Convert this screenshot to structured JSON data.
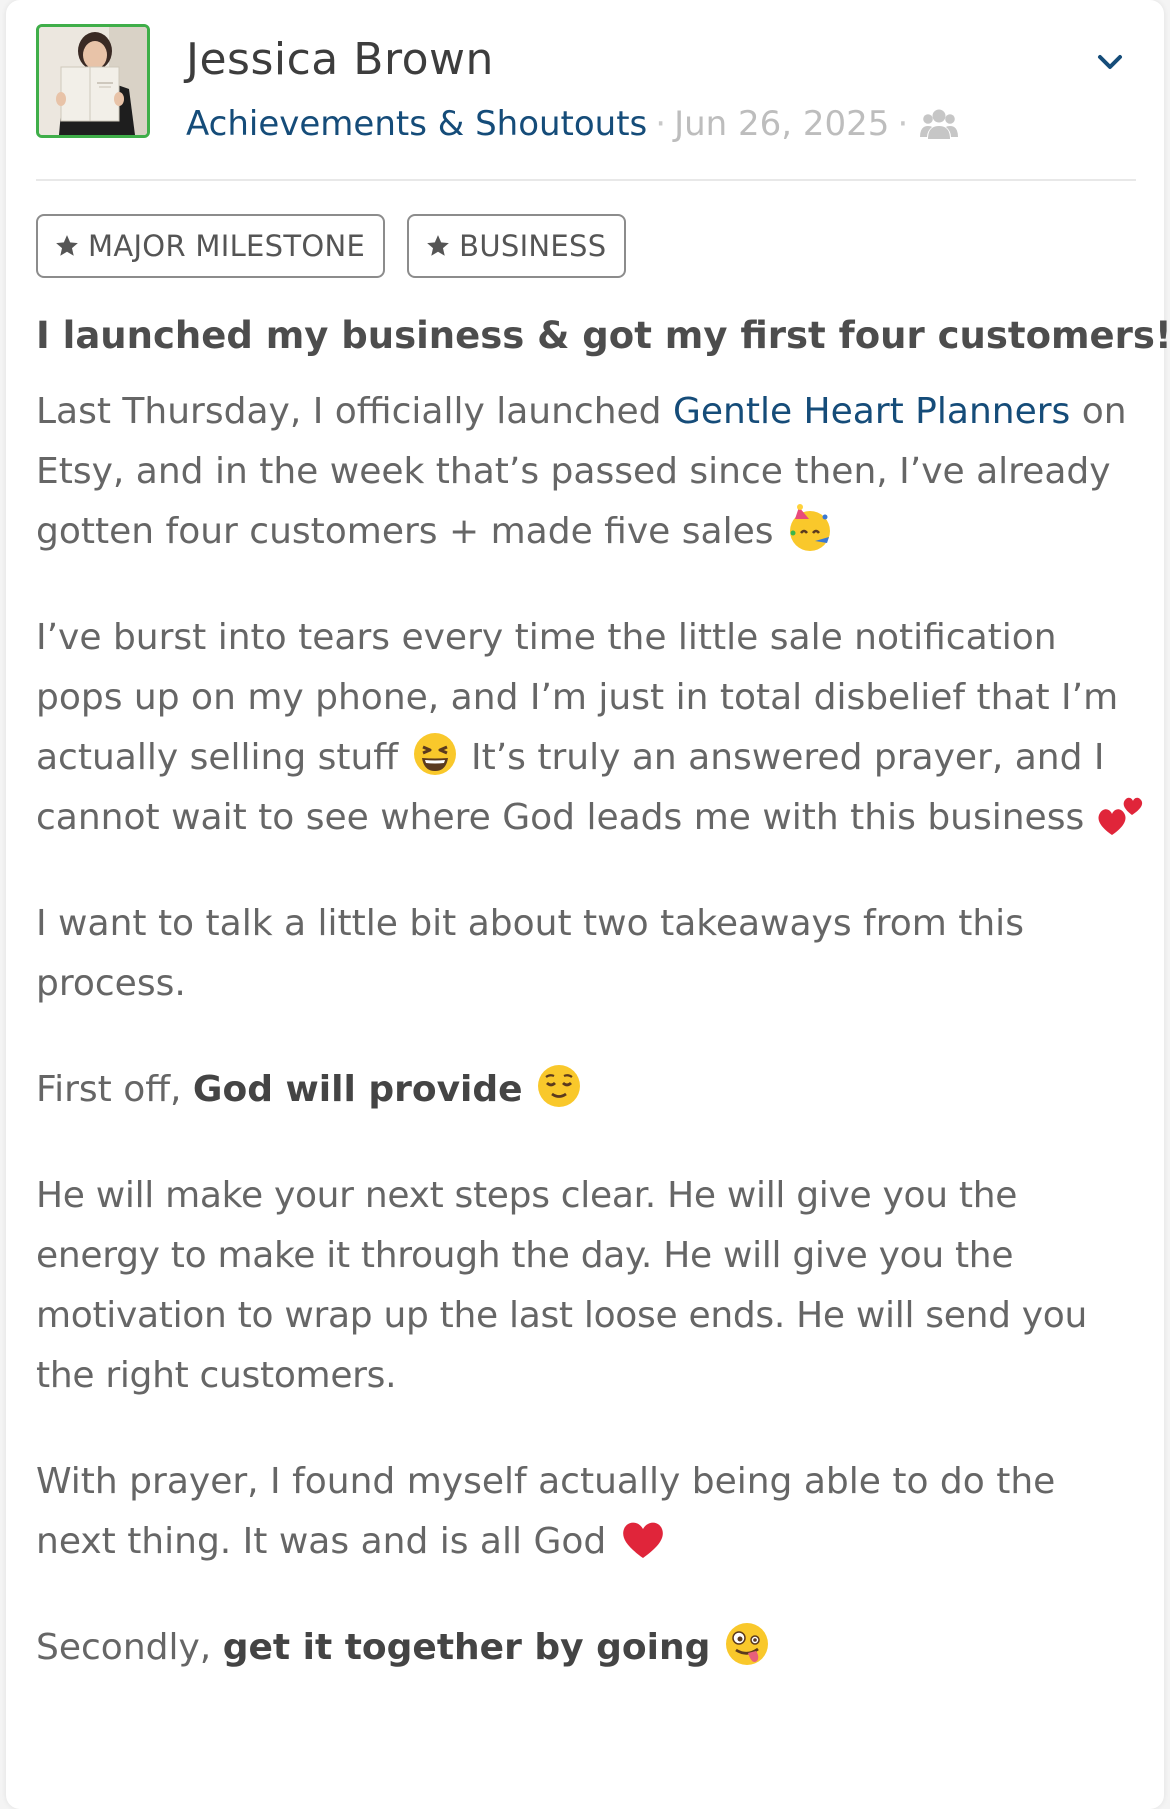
{
  "post": {
    "author_name": "Jessica Brown",
    "category": "Achievements & Shoutouts",
    "separator": "·",
    "date": "Jun 26, 2025",
    "visibility_icon": "group-icon",
    "menu_icon": "chevron-down-icon",
    "tags": [
      {
        "label": "MAJOR MILESTONE",
        "icon": "star-icon"
      },
      {
        "label": "BUSINESS",
        "icon": "star-icon"
      }
    ],
    "title": "I launched my business & got my first four customers!!",
    "body": {
      "p1_before": "Last Thursday, I officially launched ",
      "p1_link": "Gentle Heart Planners",
      "p1_after": " on Etsy, and in the week that’s passed since then, I’ve already gotten four customers + made five sales",
      "p1_emoji": "party-face-emoji",
      "p2_before": "I’ve burst into tears every time the little sale notification pops up on my phone, and I’m just in total disbelief that I’m actually selling stuff",
      "p2_emoji1": "laughing-face-emoji",
      "p2_after": " It’s truly an answered prayer, and I cannot wait to see where God leads me with this business",
      "p2_emoji2": "two-hearts-emoji",
      "p3": "I want to talk a little bit about two takeaways from this process.",
      "p4_before": "First off, ",
      "p4_bold": "God will provide",
      "p4_emoji": "relieved-face-emoji",
      "p5": "He will make your next steps clear. He will give you the energy to make it through the day. He will give you the motivation to wrap up the last loose ends. He will send you the right customers.",
      "p6": "With prayer, I found myself actually being able to do the next thing. It was and is all God",
      "p6_emoji": "red-heart-emoji",
      "p7_before": "Secondly, ",
      "p7_bold": "get it together by going",
      "p7_emoji": "zany-face-emoji"
    }
  },
  "colors": {
    "link": "#154c79",
    "text": "#666666",
    "avatar_border": "#3fae49",
    "meta": "#bdbdbd"
  }
}
